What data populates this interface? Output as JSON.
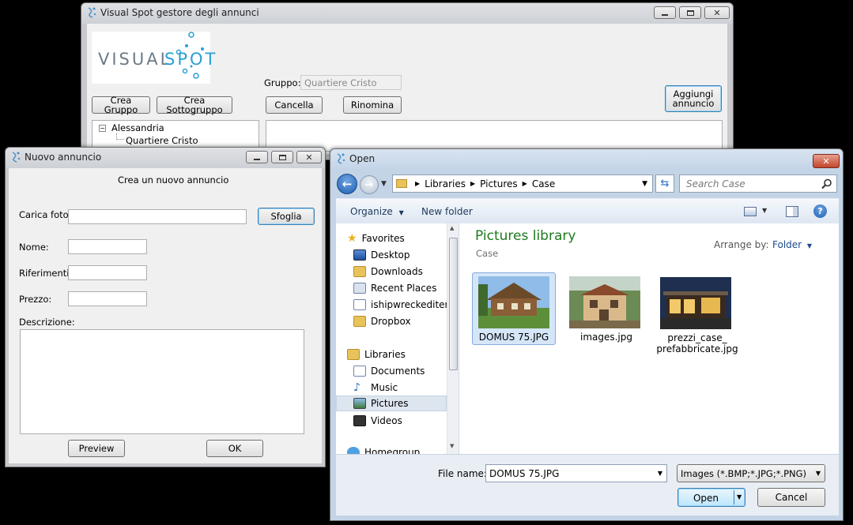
{
  "main_window": {
    "title": "Visual Spot gestore degli annunci",
    "logo_text_a": "VISUAL",
    "logo_text_b": "SPOT",
    "group_label": "Gruppo:",
    "group_value": "Quartiere Cristo",
    "buttons": {
      "crea_gruppo": "Crea Gruppo",
      "crea_sottogruppo": "Crea Sottogruppo",
      "cancella": "Cancella",
      "rinomina": "Rinomina",
      "aggiungi_line1": "Aggiungi",
      "aggiungi_line2": "annuncio"
    },
    "tree": {
      "root": "Alessandria",
      "child": "Quartiere Cristo"
    }
  },
  "new_ad_window": {
    "title": "Nuovo annuncio",
    "heading": "Crea un nuovo annuncio",
    "labels": {
      "carica_foto": "Carica foto",
      "nome": "Nome:",
      "riferimenti": "Riferimenti:",
      "prezzo": "Prezzo:",
      "descrizione": "Descrizione:"
    },
    "buttons": {
      "sfoglia": "Sfoglia",
      "preview": "Preview",
      "ok": "OK"
    }
  },
  "open_dialog": {
    "title": "Open",
    "breadcrumb": [
      "Libraries",
      "Pictures",
      "Case"
    ],
    "search_placeholder": "Search Case",
    "toolbar": {
      "organize": "Organize",
      "new_folder": "New folder"
    },
    "nav": {
      "favorites_header": "Favorites",
      "favorites": [
        "Desktop",
        "Downloads",
        "Recent Places",
        "ishipwreckediten",
        "Dropbox"
      ],
      "libraries_header": "Libraries",
      "libraries": [
        "Documents",
        "Music",
        "Pictures",
        "Videos"
      ],
      "homegroup": "Homegroup",
      "selected": "Pictures"
    },
    "library_title": "Pictures library",
    "library_subtitle": "Case",
    "arrange_label": "Arrange by:",
    "arrange_value": "Folder",
    "files": [
      {
        "name": "DOMUS 75.JPG",
        "selected": true
      },
      {
        "name": "images.jpg",
        "selected": false
      },
      {
        "name_line1": "prezzi_case_",
        "name_line2": "prefabbricate.jpg",
        "selected": false
      }
    ],
    "file_name_label": "File name:",
    "file_name_value": "DOMUS 75.JPG",
    "file_type_value": "Images (*.BMP;*.JPG;*.PNG)",
    "open_button": "Open",
    "cancel_button": "Cancel"
  },
  "colors": {
    "explorer_title_green": "#1e7a1e",
    "link_blue": "#1a4a8c",
    "logo_blue": "#2a9fd6",
    "logo_gray": "#6d7b8a"
  }
}
